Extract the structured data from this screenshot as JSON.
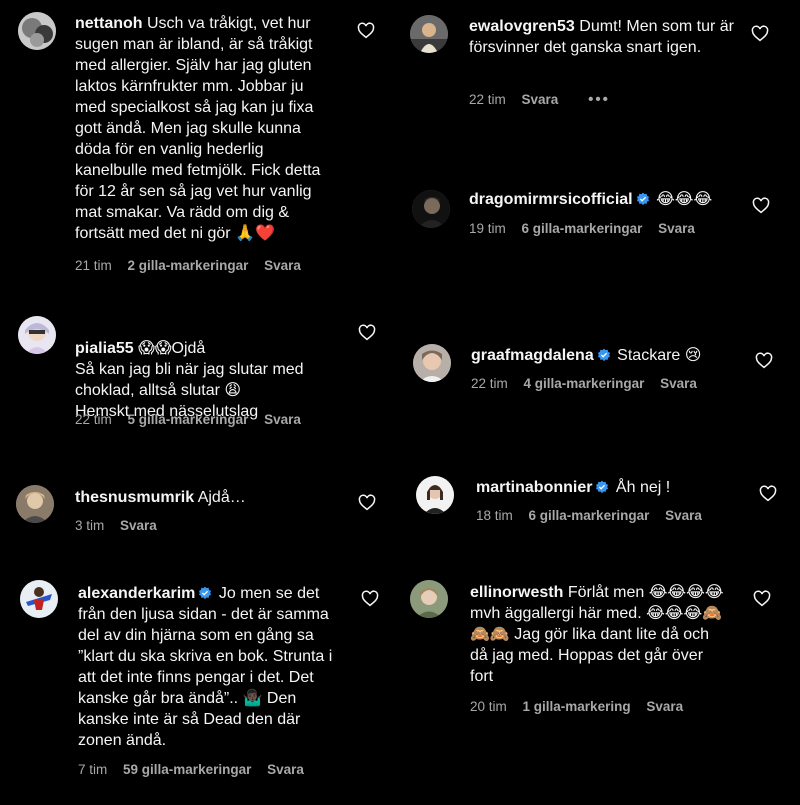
{
  "left": [
    {
      "username": "nettanoh",
      "verified": false,
      "text": "Usch va tråkigt, vet hur sugen man är ibland, är så tråkigt med allergier. Själv har jag gluten laktos kärnfrukter mm. Jobbar ju med specialkost så jag kan ju fixa gott ändå. Men jag skulle kunna döda för en vanlig hederlig kanelbulle med fetmjölk. Fick detta för 12 år sen så jag vet hur vanlig mat smakar. Va rädd om dig & fortsätt med det ni gör 🙏❤️",
      "time": "21 tim",
      "likes": "2 gilla-markeringar",
      "reply": "Svara"
    },
    {
      "username": "pialia55",
      "verified": false,
      "text": "😱😱Ojdå\nSå kan jag bli när jag slutar med choklad, alltså slutar 😩\nHemskt med nässelutslag",
      "time": "22 tim",
      "likes": "5 gilla-markeringar",
      "reply": "Svara"
    },
    {
      "username": "thesnusmumrik",
      "verified": false,
      "text": "Ajdå…",
      "time": "3 tim",
      "likes": "",
      "reply": "Svara"
    },
    {
      "username": "alexanderkarim",
      "verified": true,
      "text": "Jo men se det från den ljusa sidan - det är samma del av din hjärna som en gång sa ”klart du ska skriva en bok. Strunta i att det inte finns pengar i det. Det kanske går bra ändå”.. 🤷🏿‍♂️ Den kanske inte är så Dead den där zonen ändå.",
      "time": "7 tim",
      "likes": "59 gilla-markeringar",
      "reply": "Svara"
    }
  ],
  "right": [
    {
      "username": "ewalovgren53",
      "verified": false,
      "text": "Dumt! Men som tur är försvinner det ganska snart igen.",
      "time": "22 tim",
      "likes": "",
      "reply": "Svara",
      "more": "•••"
    },
    {
      "username": "dragomirmrsicofficial",
      "verified": true,
      "text": "😂😂😂",
      "time": "19 tim",
      "likes": "6 gilla-markeringar",
      "reply": "Svara"
    },
    {
      "username": "graafmagdalena",
      "verified": true,
      "text": "Stackare 😢",
      "time": "22 tim",
      "likes": "4 gilla-markeringar",
      "reply": "Svara"
    },
    {
      "username": "martinabonnier",
      "verified": true,
      "text": "Åh nej !",
      "time": "18 tim",
      "likes": "6 gilla-markeringar",
      "reply": "Svara"
    },
    {
      "username": "ellinorwesth",
      "verified": false,
      "text": "Förlåt men 😂😂😂😂 mvh äggallergi här med. 😂😂😂🙈🙈🙈 Jag gör lika dant lite då och då jag med. Hoppas det går över fort",
      "time": "20 tim",
      "likes": "1 gilla-markering",
      "reply": "Svara"
    }
  ],
  "colors": {
    "background": "#000000",
    "text": "#f5f5f5",
    "meta": "#a8a8a8",
    "verified": "#3897f0"
  },
  "icons": {
    "like": "heart-icon",
    "verified": "verified-badge-icon",
    "more": "more-options-icon"
  }
}
